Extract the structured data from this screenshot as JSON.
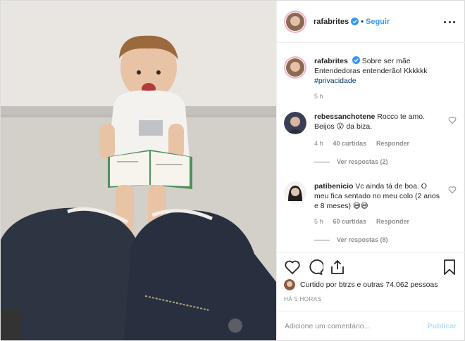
{
  "post": {
    "author": "rafabrites",
    "dot": "•",
    "follow_label": "Seguir"
  },
  "caption": {
    "username": "rafabrites",
    "text": "Sobre ser mãe Entendedoras entenderão! Kkkkkk",
    "hashtag": "#privacidade",
    "time": "5 h"
  },
  "comments": [
    {
      "username": "rebessanchotene",
      "text": "Rocco te amo. Beijos 😮 da biza.",
      "time": "4 h",
      "likes": "40 curtidas",
      "reply_label": "Responder",
      "view_replies": "Ver respostas (2)"
    },
    {
      "username": "patibenicio",
      "text": "Vc ainda tá de boa. O meu fica sentado no meu colo (2 anos e 8 meses) 😅😅",
      "time": "5 h",
      "likes": "60 curtidas",
      "reply_label": "Responder",
      "view_replies": "Ver respostas (8)"
    }
  ],
  "likes_line": "Curtido por btrzs e outras 74.062 pessoas",
  "timestamp": "HÁ 5 HORAS",
  "add_comment": {
    "placeholder": "Adicione um comentário...",
    "publish_label": "Publicar"
  },
  "colors": {
    "link_blue": "#3897f0",
    "hashtag": "#003569",
    "muted": "#8e8e8e"
  },
  "icons": [
    "heart-icon",
    "comment-icon",
    "share-icon",
    "bookmark-icon",
    "more-icon",
    "verified-icon"
  ]
}
